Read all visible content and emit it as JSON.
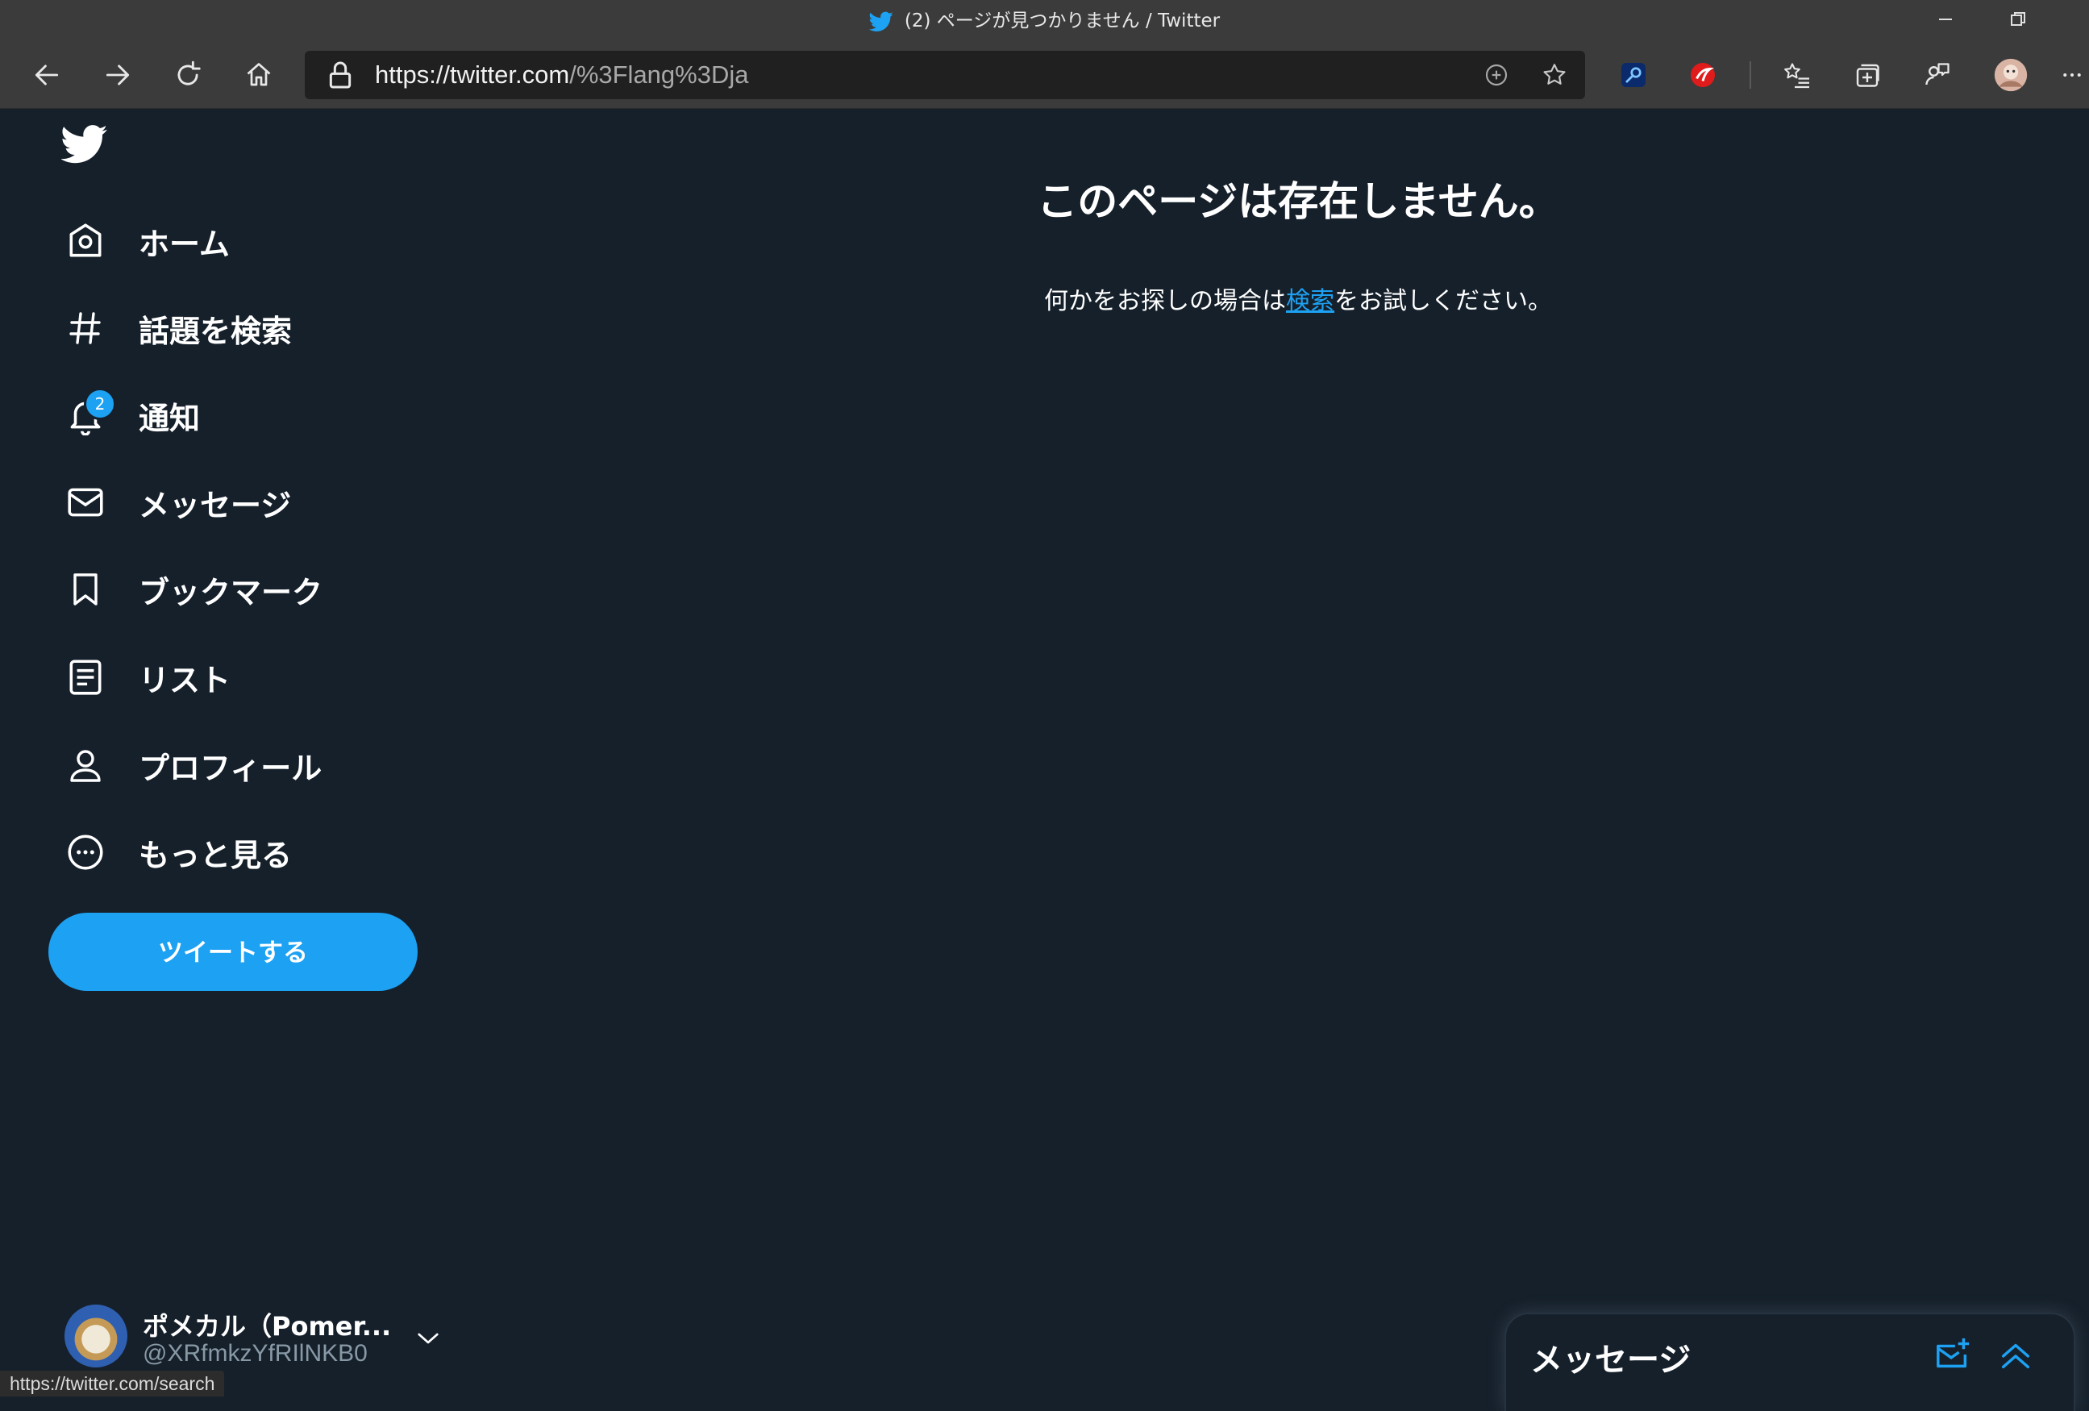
{
  "browser": {
    "window_title": "(2) ページが見つかりません / Twitter",
    "url_host": "https://twitter.com",
    "url_path": "/%3Flang%3Dja",
    "status_url": "https://twitter.com/search"
  },
  "sidebar": {
    "items": [
      {
        "label": "ホーム",
        "icon": "home-icon"
      },
      {
        "label": "話題を検索",
        "icon": "hashtag-icon"
      },
      {
        "label": "通知",
        "icon": "bell-icon"
      },
      {
        "label": "メッセージ",
        "icon": "envelope-icon"
      },
      {
        "label": "ブックマーク",
        "icon": "bookmark-icon"
      },
      {
        "label": "リスト",
        "icon": "list-icon"
      },
      {
        "label": "プロフィール",
        "icon": "person-icon"
      },
      {
        "label": "もっと見る",
        "icon": "more-circle-icon"
      }
    ],
    "notification_count": "2",
    "tweet_button": "ツイートする"
  },
  "account": {
    "name": "ポメカル（Pomer...",
    "handle": "@XRfmkzYfRIlNKB0"
  },
  "main": {
    "heading": "このページは存在しません。",
    "message_before": "何かをお探しの場合は",
    "message_link": "検索",
    "message_after": "をお試しください。"
  },
  "messages_drawer": {
    "title": "メッセージ"
  },
  "colors": {
    "background": "#15202b",
    "accent": "#1da1f2",
    "chrome": "#3b3b3b"
  }
}
